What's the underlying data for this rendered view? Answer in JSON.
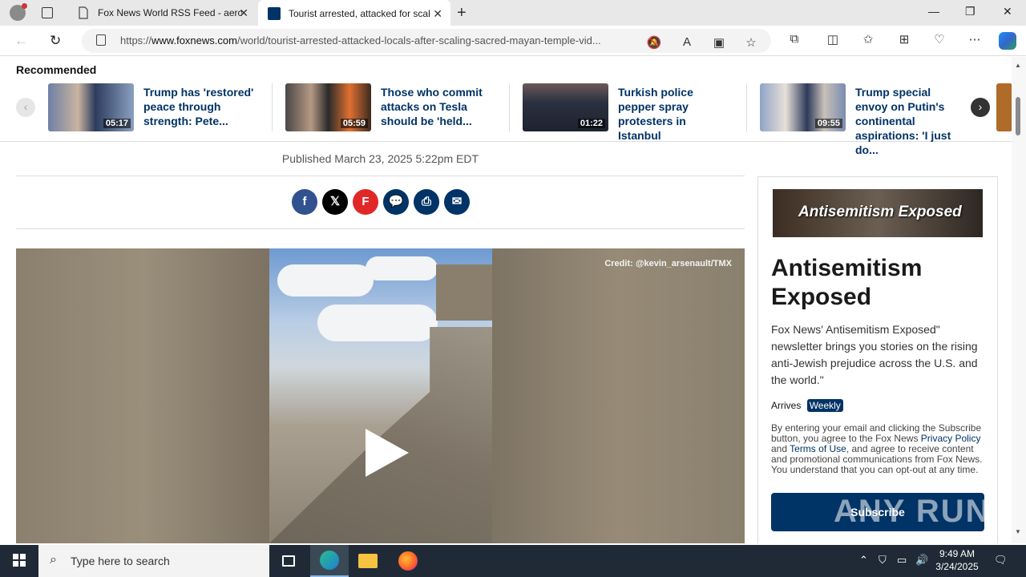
{
  "browser": {
    "tabs": [
      {
        "title": "Fox News World RSS Feed - aerop"
      },
      {
        "title": "Tourist arrested, attacked for scal",
        "active": true
      }
    ],
    "url_prefix": "https://",
    "url_host": "www.foxnews.com",
    "url_path": "/world/tourist-arrested-attacked-locals-after-scaling-sacred-mayan-temple-vid..."
  },
  "recommended": {
    "title": "Recommended",
    "items": [
      {
        "headline": "Trump has 'restored' peace through strength: Pete...",
        "duration": "05:17"
      },
      {
        "headline": "Those who commit attacks on Tesla should be 'held...",
        "duration": "05:59"
      },
      {
        "headline": "Turkish police pepper spray protesters in Istanbul",
        "duration": "01:22"
      },
      {
        "headline": "Trump special envoy on Putin's continental aspirations: 'I just do...",
        "duration": "09:55"
      }
    ]
  },
  "article": {
    "published": "Published March 23, 2025 5:22pm EDT",
    "share_icons": [
      "facebook-icon",
      "x-icon",
      "flipboard-icon",
      "comment-icon",
      "print-icon",
      "email-icon"
    ],
    "video_credit": "Credit: @kevin_arsenault/TMX"
  },
  "newsletter": {
    "banner_text": "Antisemitism Exposed",
    "title": "Antisemitism Exposed",
    "description": "Fox News' Antisemitism Exposed\" newsletter brings you stories on the rising anti-Jewish prejudice across the U.S. and the world.\"",
    "arrives_label": "Arrives",
    "frequency": "Weekly",
    "legal_1": "By entering your email and clicking the Subscribe button, you agree to the Fox News ",
    "privacy_link": "Privacy Policy",
    "legal_2": " and ",
    "terms_link": "Terms of Use",
    "legal_3": ", and agree to receive content and promotional communications from Fox News. You understand that you can opt-out at any time.",
    "subscribe_label": "Subscribe"
  },
  "watermark": "ANY RUN",
  "taskbar": {
    "search_placeholder": "Type here to search",
    "time": "9:49 AM",
    "date": "3/24/2025"
  },
  "colors": {
    "accent": "#003366",
    "taskbar": "#1f2a36"
  }
}
